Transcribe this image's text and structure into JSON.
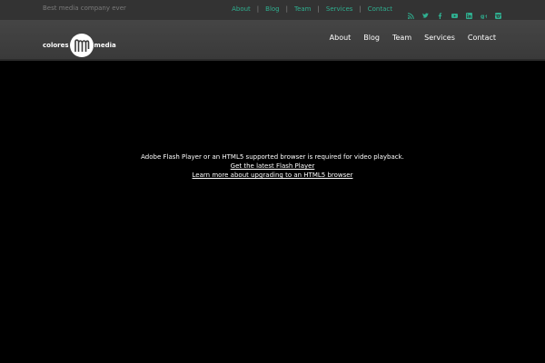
{
  "topbar": {
    "tagline": "Best media company ever",
    "links": [
      "About",
      "Blog",
      "Team",
      "Services",
      "Contact"
    ],
    "link_color": "#2fae8f",
    "social_icons": [
      "rss-icon",
      "twitter-icon",
      "facebook-icon",
      "youtube-icon",
      "linkedin-icon",
      "googleplus-icon",
      "instagram-icon"
    ]
  },
  "header": {
    "logo_left": "colores",
    "logo_right": "media",
    "nav": [
      "About",
      "Blog",
      "Team",
      "Services",
      "Contact"
    ]
  },
  "video": {
    "message": "Adobe Flash Player or an HTML5 supported browser is required for video playback.",
    "link1": "Get the latest Flash Player",
    "link2": "Learn more about upgrading to an HTML5 browser"
  }
}
